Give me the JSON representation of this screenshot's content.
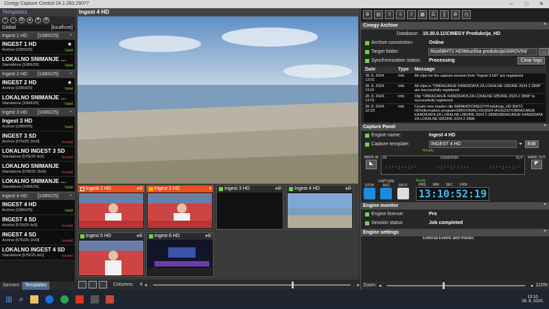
{
  "window": {
    "title": "Cinegy Capture Control 24.1.283.29077"
  },
  "left": {
    "header": "Templates",
    "global": "Global",
    "host": "[localhost]",
    "groups": [
      {
        "name": "Ingest 1 HD",
        "fmt": "[1080i/25]",
        "items": [
          {
            "name": "INGEST 1 HD",
            "sub": "Archive [1080i/25]",
            "status": "Valid",
            "star": "★"
          },
          {
            "name": "LOKALNO SNIMANJE HD I...",
            "sub": "Standalone [1080i/25]",
            "status": "Valid"
          }
        ]
      },
      {
        "name": "Ingest 2 HD",
        "fmt": "[1080i/25]",
        "items": [
          {
            "name": "INGEST 2 HD",
            "sub": "Archive [1080i/25]",
            "status": "Valid",
            "star": "★"
          },
          {
            "name": "LOKALNO SNIMANJE HD I...",
            "sub": "Standalone [1080i/25]",
            "status": "Valid"
          }
        ]
      },
      {
        "name": "Ingest 3 HD",
        "fmt": "[1080i/25]",
        "items": [
          {
            "name": "Ingest 3 HD",
            "sub": "Archive [1080i/25]",
            "status": "Valid"
          },
          {
            "name": "INGEST 3 SD",
            "sub": "Archive [576i/25 16x9]",
            "status": "Invalid"
          },
          {
            "name": "LOKALNO INGEST 3 SD",
            "sub": "Standalone [576i/25 4x3]",
            "status": "Invalid"
          },
          {
            "name": "LOKALNO SNIMANJE",
            "sub": "Standalone [576i/25 16x9]",
            "status": "Invalid"
          },
          {
            "name": "LOKALNO SNIMANJE HD I...",
            "sub": "Standalone [1080i/25]",
            "status": "Valid"
          }
        ]
      },
      {
        "name": "Ingest 4 HD",
        "fmt": "[1080i/25]",
        "items": [
          {
            "name": "INGEST 4 HD",
            "sub": "Archive [1080i/25]",
            "status": "Valid"
          },
          {
            "name": "INGEST 4 SD",
            "sub": "Archive [576i/25 4x3]",
            "status": "Invalid"
          },
          {
            "name": "INGEST 4 SD",
            "sub": "Archive [576i/25 16x9]",
            "status": "Invalid"
          },
          {
            "name": "LOKALNO INGEST 4 SD",
            "sub": "Standalone [576i/25 4x3]",
            "status": "Invalid"
          }
        ]
      }
    ],
    "tabs": [
      "Servers",
      "Templates"
    ]
  },
  "center": {
    "title": "Ingest 4 HD",
    "thumbs": [
      "Ingest 1 HD",
      "Ingest 2 HD",
      "Ingest 3 HD",
      "Ingest 4 HD",
      "Ingest 5 HD",
      "Ingest 6 HD"
    ],
    "columns_label": "Columns:",
    "columns_value": "4"
  },
  "right": {
    "archive": {
      "title": "Cinegy Archive",
      "db_label": "Database:",
      "db_value": "10.30.0.11\\CINEGY    Produkcija_HD",
      "conn_label": "Archive connection:",
      "conn_value": "Online",
      "target_label": "Target folder:",
      "target_value": "Root\\BHT1 HD\\Muzička produkcija\\SIROVIN/",
      "sync_label": "Synchronization status:",
      "sync_value": "Processing",
      "clear": "Clear logs",
      "log_headers": [
        "Date",
        "Type",
        "Message"
      ],
      "log": [
        [
          "28. 8. 2024. 13:01",
          "Info",
          "All clips for the capture session from \"Ingest 3 HD\" are registered"
        ],
        [
          "28. 8. 2024. 13:01",
          "Info",
          "All clips in \"OBRACANJE KANDIDATA ZA LOKALNE IZBORE 2024 2 2808\" are successfully registered"
        ],
        [
          "28. 8. 2024. 13:01",
          "Info",
          "Clip \"OBRACANJE KANDIDATA ZA LOKALNE IZBORE 2024 2 2808\" is successfully registered"
        ],
        [
          "28. 8. 2024. 12:23",
          "Info",
          "Create new master clip \\MAMHD\\CINEGY\\Produkcija_HD \\BHT1 HD\\informativni program\\SIROVINA\\LIVE\\2024 \\AUGUST\\OBRACANJE KANDIDATA ZA LOKALNE IZBORE 2024 2 2808\\OBRACANJE KANDIDATA ZA LOKALNE IZBORE 2024 2 2808"
        ]
      ]
    },
    "capture": {
      "title": "Capture Panel",
      "engine_label": "Engine name:",
      "engine_value": "Ingest 4 HD",
      "template_label": "Capture template:",
      "template_value": "INGEST 4 HD",
      "edit": "Edit",
      "ready": "Ready",
      "mark_in": "MARK IN",
      "in": "IN",
      "duration": "DURATION",
      "out": "OUT",
      "mark_out": "MARK OUT",
      "capture": "CAPTURE",
      "stop": "STOP",
      "rec": "REC",
      "split": "SPLIT",
      "hrs": "HRS",
      "min": "MIN",
      "sec": "SEC",
      "frm": "FRM",
      "timecode": "13:10:52:19",
      "tc_blank": "-:--:--:--",
      "tc_ready": "Ready"
    },
    "monitor": {
      "title": "Engine monitor",
      "license_label": "Engine license:",
      "license_value": "Pro",
      "session_label": "Session status",
      "session_value": "Job completed"
    },
    "settings": {
      "title": "Engine settings",
      "sub": "External Events and Routes"
    },
    "zoom_label": "Zoom:",
    "zoom_value": "110%"
  },
  "taskbar": {
    "time": "13:10",
    "date": "28. 8. 2024."
  }
}
